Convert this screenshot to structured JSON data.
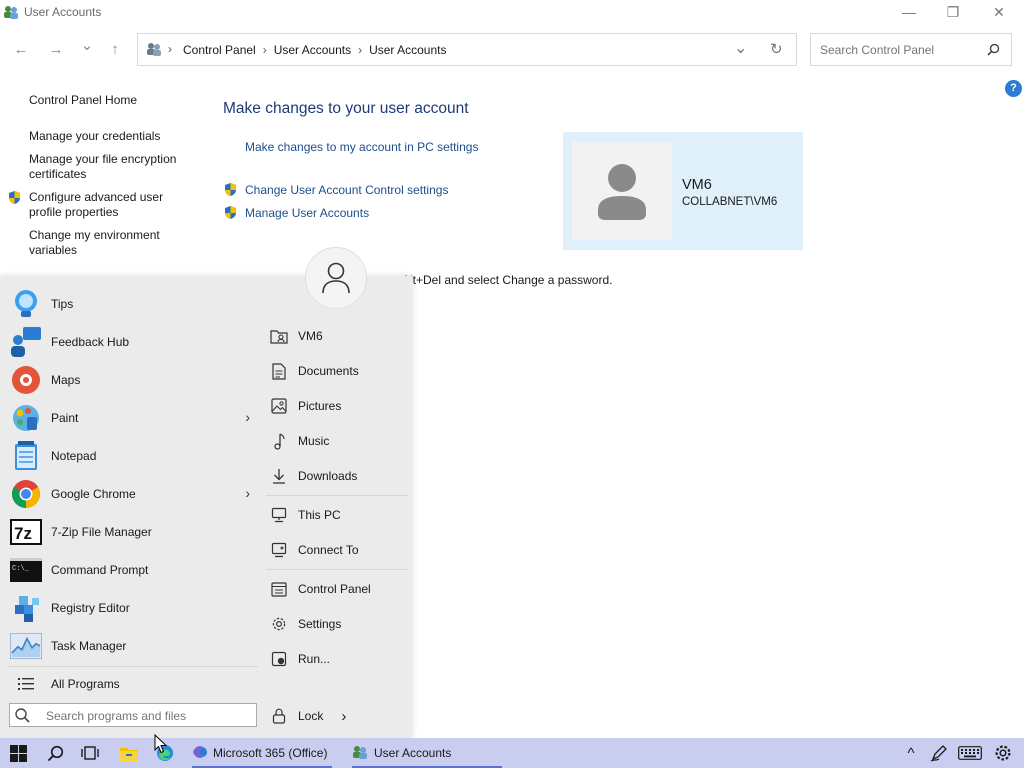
{
  "window": {
    "title": "User Accounts",
    "minimize_glyph": "—",
    "maximize_glyph": "❐",
    "close_glyph": "✕"
  },
  "nav": {
    "back_glyph": "←",
    "forward_glyph": "→",
    "recent_glyph": "⌄",
    "up_glyph": "↑",
    "breadcrumbs": [
      "Control Panel",
      "User Accounts",
      "User Accounts"
    ],
    "separator": "›",
    "dropdown_glyph": "⌄",
    "refresh_glyph": "↻",
    "search_placeholder": "Search Control Panel"
  },
  "sidebar": {
    "items": [
      {
        "label": "Control Panel Home"
      },
      {
        "label": "Manage your credentials"
      },
      {
        "label": "Manage your file encryption certificates"
      },
      {
        "label": "Configure advanced user profile properties"
      },
      {
        "label": "Change my environment variables"
      }
    ]
  },
  "main": {
    "heading": "Make changes to your user account",
    "links": [
      {
        "label": "Make changes to my account in PC settings"
      },
      {
        "label": "Change User Account Control settings"
      },
      {
        "label": "Manage User Accounts"
      }
    ],
    "user": {
      "name": "VM6",
      "domain": "COLLABNET\\VM6"
    },
    "password_hint": "+Alt+Del and select Change a password.",
    "help_glyph": "?"
  },
  "start_menu": {
    "programs": [
      {
        "label": "Tips",
        "icon": "tips-icon"
      },
      {
        "label": "Feedback Hub",
        "icon": "feedback-hub-icon"
      },
      {
        "label": "Maps",
        "icon": "maps-icon"
      },
      {
        "label": "Paint",
        "icon": "paint-icon",
        "has_submenu": true
      },
      {
        "label": "Notepad",
        "icon": "notepad-icon"
      },
      {
        "label": "Google Chrome",
        "icon": "chrome-icon",
        "has_submenu": true
      },
      {
        "label": "7-Zip File Manager",
        "icon": "7zip-icon"
      },
      {
        "label": "Command Prompt",
        "icon": "command-prompt-icon"
      },
      {
        "label": "Registry Editor",
        "icon": "registry-editor-icon"
      },
      {
        "label": "Task Manager",
        "icon": "task-manager-icon"
      }
    ],
    "all_programs": "All Programs",
    "submenu_glyph": "›",
    "search_placeholder": "Search programs and files",
    "right_items": [
      {
        "label": "VM6",
        "icon": "user-folder-icon"
      },
      {
        "label": "Documents",
        "icon": "documents-icon"
      },
      {
        "label": "Pictures",
        "icon": "pictures-icon"
      },
      {
        "label": "Music",
        "icon": "music-icon"
      },
      {
        "label": "Downloads",
        "icon": "downloads-icon"
      },
      {
        "label": "This PC",
        "icon": "this-pc-icon"
      },
      {
        "label": "Connect To",
        "icon": "connect-to-icon"
      },
      {
        "label": "Control Panel",
        "icon": "control-panel-icon"
      },
      {
        "label": "Settings",
        "icon": "settings-gear-icon"
      },
      {
        "label": "Run...",
        "icon": "run-icon"
      }
    ],
    "lock_label": "Lock",
    "lock_arrow": "›"
  },
  "taskbar": {
    "apps": [
      {
        "label": "Microsoft 365 (Office)"
      },
      {
        "label": "User Accounts"
      }
    ],
    "tray_chevron": "^"
  },
  "colors": {
    "link": "#1f4e8c",
    "heading": "#1e3a78",
    "user_card": "#dff0fb",
    "taskbar": "#c9cdf0",
    "start_menu": "#ebebeb"
  }
}
